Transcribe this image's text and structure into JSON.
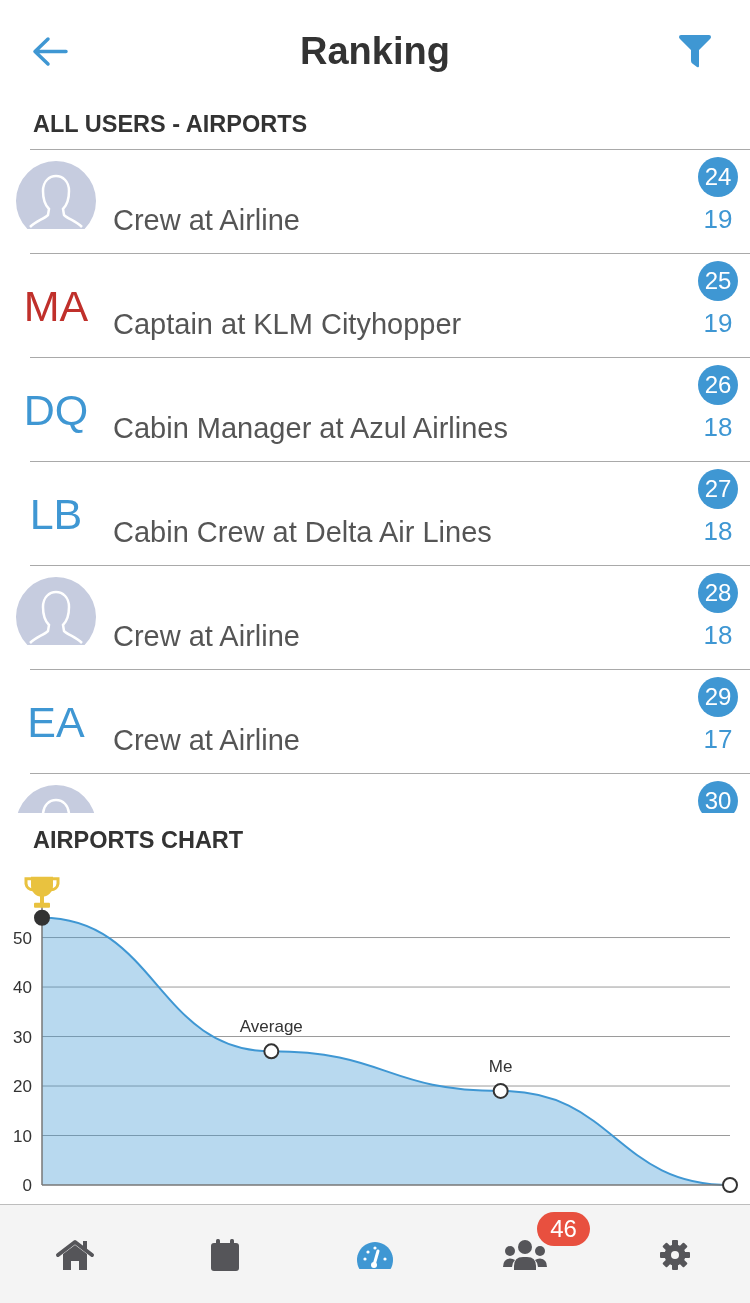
{
  "header": {
    "title": "Ranking"
  },
  "list_section": {
    "heading": "ALL USERS - AIRPORTS",
    "rows": [
      {
        "avatar": {
          "kind": "silhouette"
        },
        "subtitle": "Crew at Airline",
        "rank": "24",
        "score": "19"
      },
      {
        "avatar": {
          "kind": "initials",
          "text": "MA",
          "color": "#c0302b"
        },
        "subtitle": "Captain at KLM Cityhopper",
        "rank": "25",
        "score": "19"
      },
      {
        "avatar": {
          "kind": "initials",
          "text": "DQ",
          "color": "#3f97d3"
        },
        "subtitle": "Cabin Manager at Azul Airlines",
        "rank": "26",
        "score": "18"
      },
      {
        "avatar": {
          "kind": "initials",
          "text": "LB",
          "color": "#3f97d3"
        },
        "subtitle": "Cabin Crew at Delta Air Lines",
        "rank": "27",
        "score": "18"
      },
      {
        "avatar": {
          "kind": "silhouette"
        },
        "subtitle": "Crew at Airline",
        "rank": "28",
        "score": "18"
      },
      {
        "avatar": {
          "kind": "initials",
          "text": "EA",
          "color": "#3f97d3"
        },
        "subtitle": "Crew at Airline",
        "rank": "29",
        "score": "17"
      },
      {
        "avatar": {
          "kind": "silhouette"
        },
        "rank": "30"
      }
    ]
  },
  "chart_section": {
    "heading": "AIRPORTS CHART",
    "chart_data": {
      "type": "area",
      "series": [
        {
          "color": "#3f97d3",
          "values": [
            54,
            27,
            19,
            0
          ]
        }
      ],
      "ylim": [
        0,
        59
      ],
      "yticks": [
        0,
        10,
        20,
        30,
        40,
        50
      ],
      "grid": true,
      "annotations": [
        {
          "y": 27,
          "text": "Average"
        },
        {
          "y": 19,
          "text": "Me"
        }
      ]
    }
  },
  "tab_bar": {
    "items": [
      {
        "kind": "home",
        "selected": false
      },
      {
        "kind": "calendar",
        "selected": false
      },
      {
        "kind": "gauge",
        "selected": true
      },
      {
        "kind": "people",
        "selected": false,
        "badge": "46"
      },
      {
        "kind": "gear",
        "selected": false
      }
    ]
  }
}
